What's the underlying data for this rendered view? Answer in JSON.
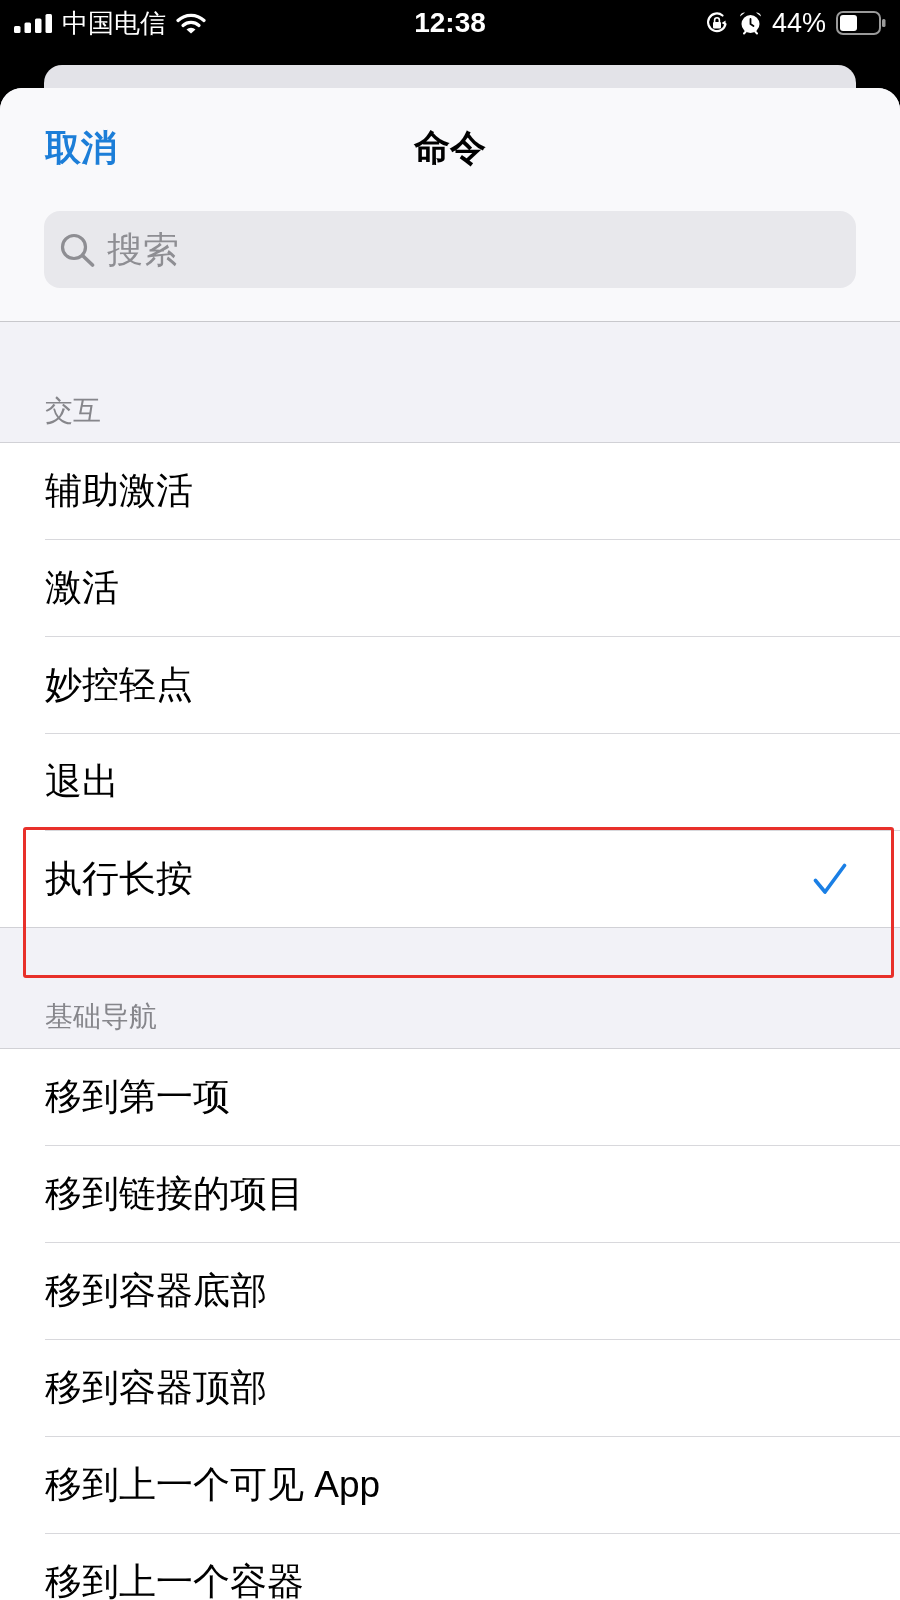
{
  "status_bar": {
    "carrier": "中国电信",
    "time": "12:38",
    "battery": "44%"
  },
  "sheet": {
    "cancel": "取消",
    "title": "命令",
    "search": {
      "placeholder": "搜索"
    }
  },
  "sections": [
    {
      "header": "交互",
      "items": [
        {
          "label": "辅助激活",
          "selected": false,
          "highlighted": false
        },
        {
          "label": "激活",
          "selected": false,
          "highlighted": false
        },
        {
          "label": "妙控轻点",
          "selected": false,
          "highlighted": false
        },
        {
          "label": "退出",
          "selected": false,
          "highlighted": false
        },
        {
          "label": "执行长按",
          "selected": true,
          "highlighted": true
        }
      ]
    },
    {
      "header": "基础导航",
      "items": [
        {
          "label": "移到第一项",
          "selected": false,
          "highlighted": false
        },
        {
          "label": "移到链接的项目",
          "selected": false,
          "highlighted": false
        },
        {
          "label": "移到容器底部",
          "selected": false,
          "highlighted": false
        },
        {
          "label": "移到容器顶部",
          "selected": false,
          "highlighted": false
        },
        {
          "label": "移到上一个可见 App",
          "selected": false,
          "highlighted": false
        },
        {
          "label": "移到上一个容器",
          "selected": false,
          "highlighted": false
        }
      ]
    }
  ]
}
